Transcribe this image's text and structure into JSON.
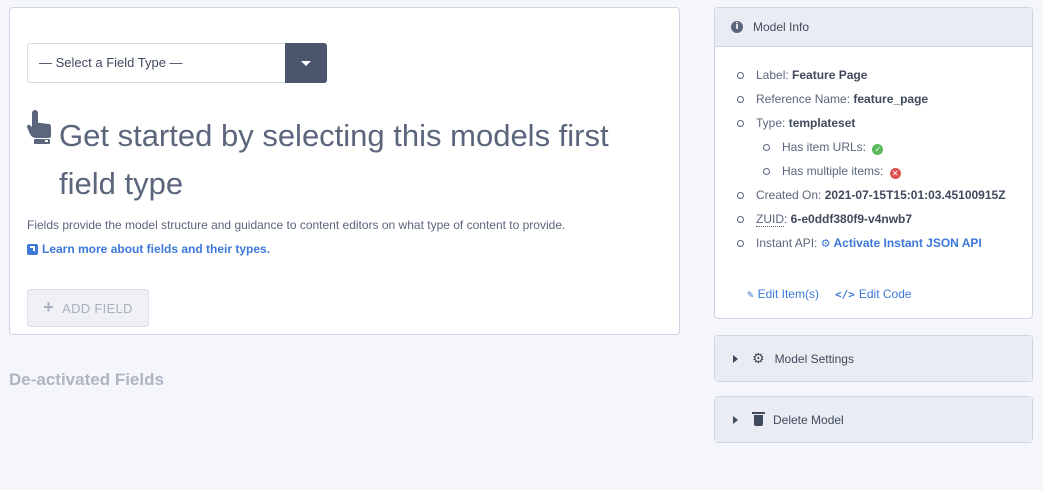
{
  "field_type_select": {
    "value": "— Select a Field Type —"
  },
  "empty_state": {
    "headline": "Get started by selecting this models first field type",
    "description": "Fields provide the model structure and guidance to content editors on what type of content to provide.",
    "learn_more": "Learn more about fields and their types."
  },
  "add_field_button": {
    "label": "ADD FIELD"
  },
  "deactivated_heading": "De-activated Fields",
  "model_info": {
    "title": "Model Info",
    "label_key": "Label:",
    "label_value": "Feature Page",
    "reference_key": "Reference Name:",
    "reference_value": "feature_page",
    "type_key": "Type:",
    "type_value": "templateset",
    "has_urls_key": "Has item URLs:",
    "has_urls_status": "yes",
    "has_multiple_key": "Has multiple items:",
    "has_multiple_status": "no",
    "created_key": "Created On:",
    "created_value": "2021-07-15T15:01:03.45100915Z",
    "zuid_key": "ZUID",
    "zuid_value": "6-e0ddf380f9-v4nwb7",
    "instant_api_key": "Instant API:",
    "instant_api_link": "Activate Instant JSON API",
    "edit_items": "Edit Item(s)",
    "edit_code": "Edit Code"
  },
  "model_settings": {
    "title": "Model Settings"
  },
  "delete_model": {
    "title": "Delete Model"
  },
  "colors": {
    "link": "#3b78d8",
    "dark_button": "#4b556b",
    "ok": "#5cb85c",
    "error": "#d9534f"
  }
}
